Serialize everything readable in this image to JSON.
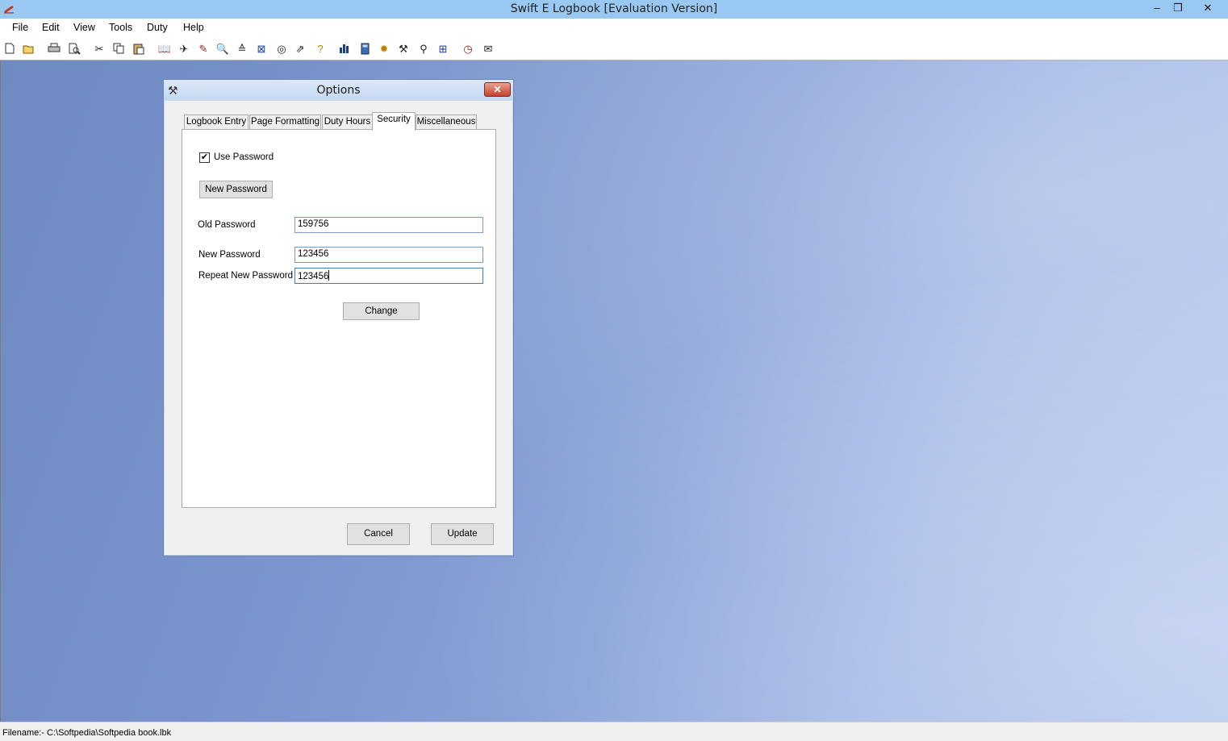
{
  "window": {
    "title": "Swift E Logbook [Evaluation Version]",
    "minimize_glyph": "–",
    "restore_glyph": "❐",
    "close_glyph": "✕"
  },
  "menu": [
    "File",
    "Edit",
    "View",
    "Tools",
    "Duty",
    "Help"
  ],
  "toolbar_icons": [
    "new-file-icon",
    "open-folder-icon",
    "print-icon",
    "print-preview-icon",
    "cut-icon",
    "copy-icon",
    "paste-icon",
    "logbook-icon",
    "aircraft-icon",
    "edit-entry-icon",
    "search-icon",
    "sort-icon",
    "map-icon",
    "globe-icon",
    "export-icon",
    "help-icon",
    "chart-icon",
    "calculator-icon",
    "settings-icon",
    "tools-icon",
    "pin-icon",
    "duty-icon",
    "clock-icon",
    "notes-icon"
  ],
  "dialog": {
    "title": "Options",
    "close_glyph": "✕",
    "tabs": [
      "Logbook Entry",
      "Page Formatting",
      "Duty Hours",
      "Security",
      "Miscellaneous"
    ],
    "active_tab": "Security",
    "security": {
      "use_password_label": "Use Password",
      "use_password_checked": true,
      "new_password_button": "New Password",
      "old_password_label": "Old Password",
      "old_password_value": "159756",
      "new_password_label": "New Password",
      "new_password_value": "123456",
      "repeat_password_label": "Repeat New Password",
      "repeat_password_value": "123456",
      "change_button": "Change"
    },
    "cancel_button": "Cancel",
    "update_button": "Update"
  },
  "status": {
    "filename": "Filename:- C:\\Softpedia\\Softpedia book.lbk"
  },
  "colors": {
    "titlebar": "#99c9f3",
    "desktop_left": "#6f89c2",
    "desktop_right": "#b4c6ee"
  }
}
